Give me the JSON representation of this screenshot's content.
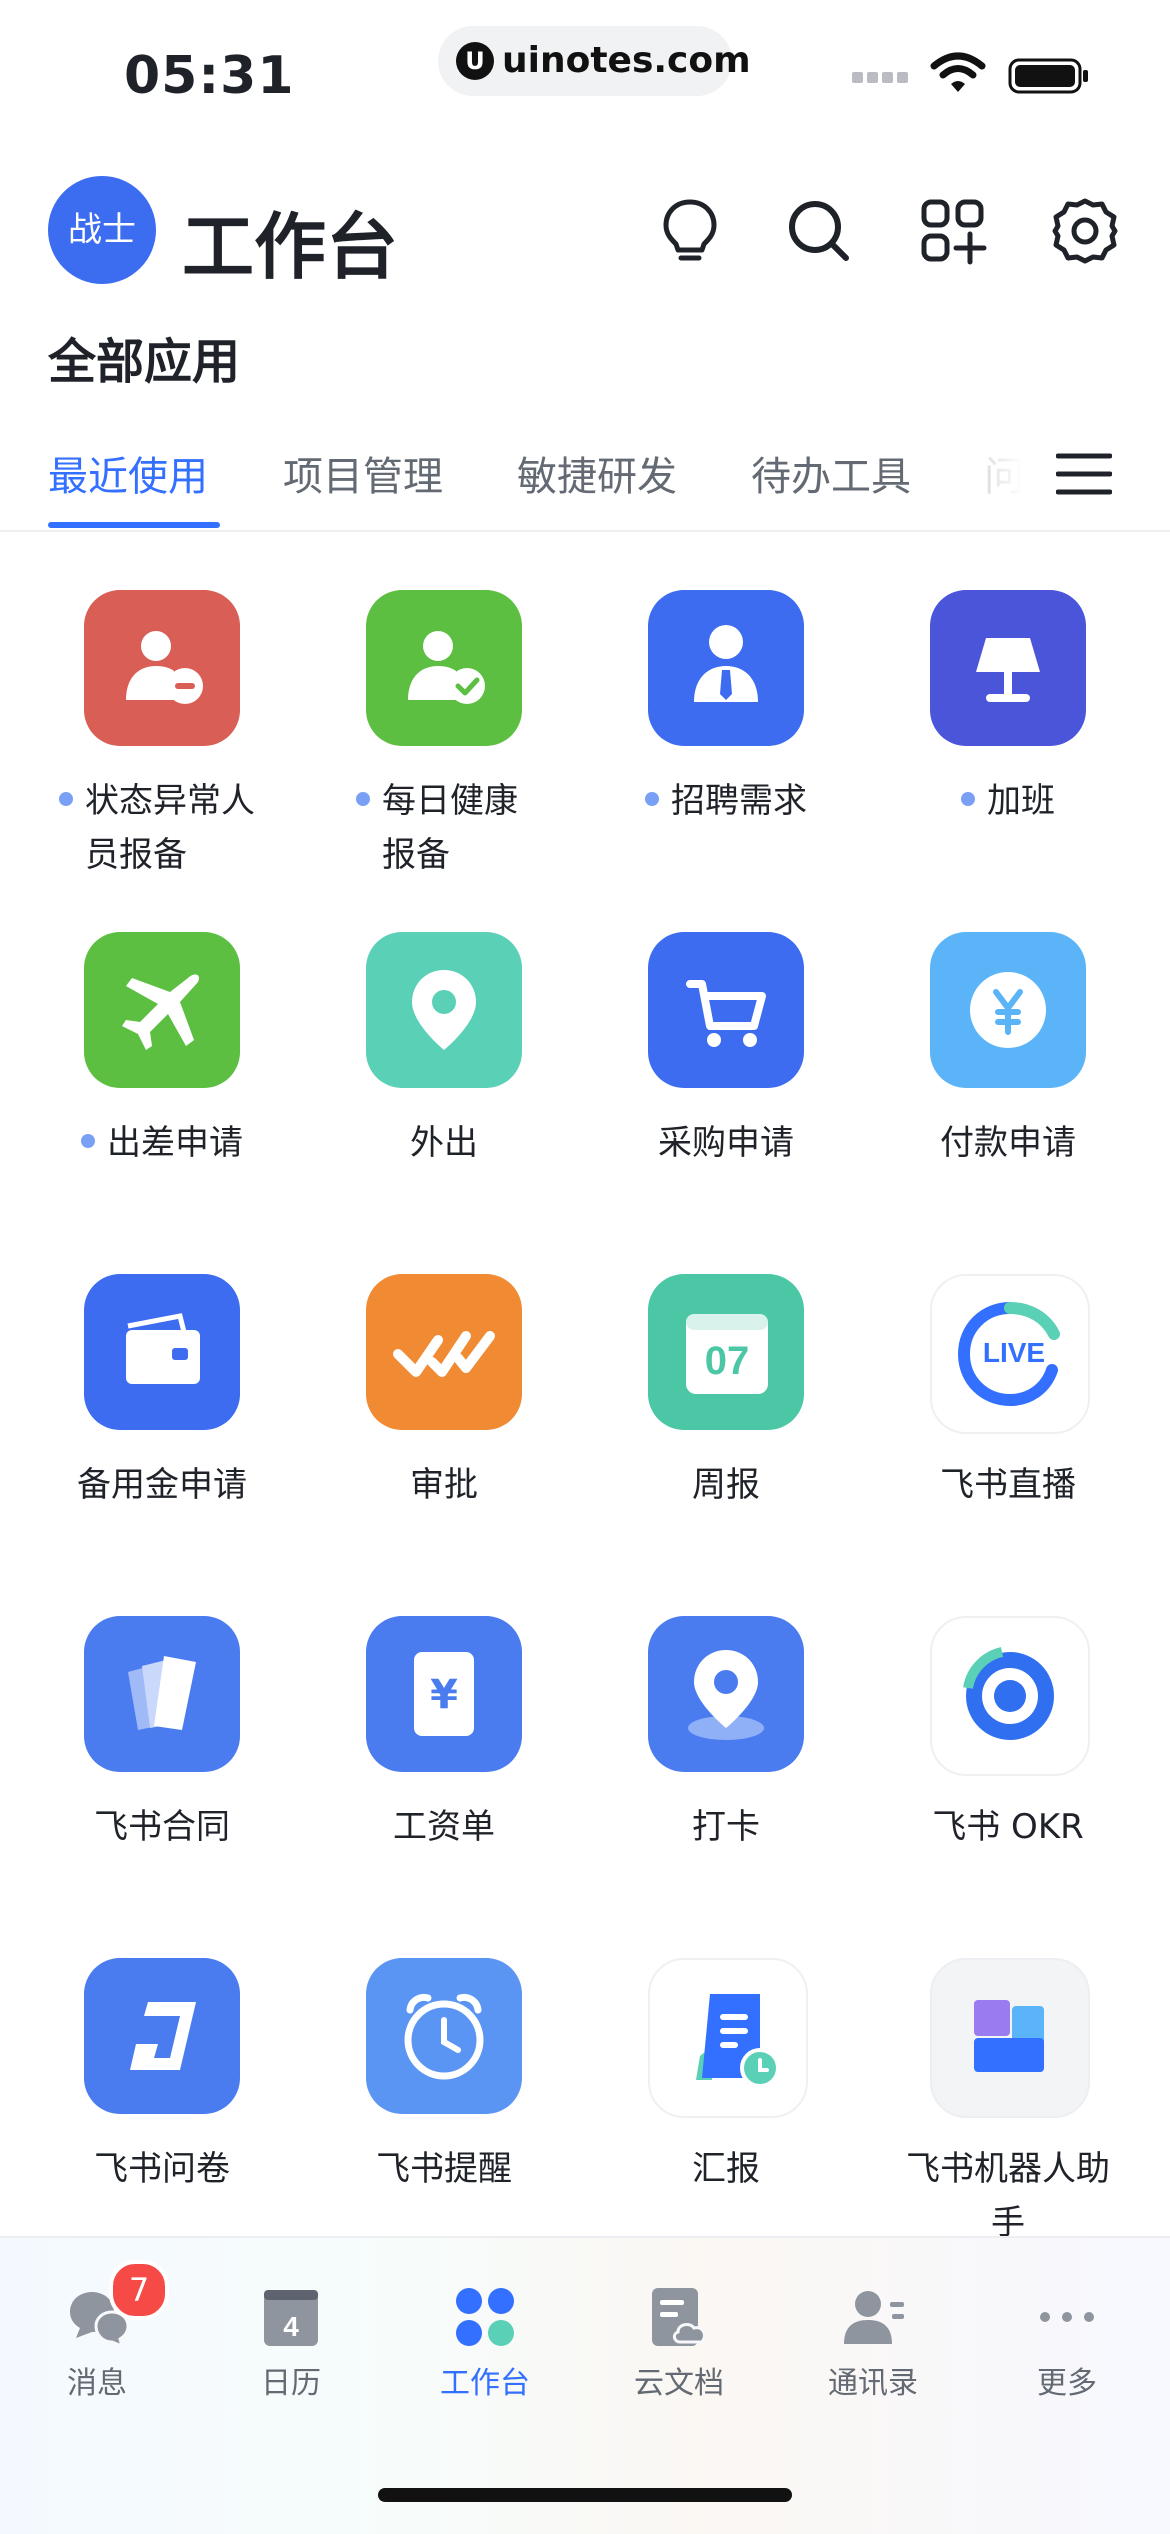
{
  "status_bar": {
    "time": "05:31",
    "url": "uinotes.com",
    "url_logo": "U"
  },
  "header": {
    "avatar_text": "战士",
    "title": "工作台"
  },
  "section_title": "全部应用",
  "tabs": [
    "最近使用",
    "项目管理",
    "敏捷研发",
    "待办工具",
    "问"
  ],
  "apps": [
    {
      "label": "状态异常人员报备",
      "dot": true,
      "icon": "user-remove-icon",
      "color": "#d95e55"
    },
    {
      "label": "每日健康报备",
      "dot": true,
      "icon": "user-check-icon",
      "color": "#5cbf42"
    },
    {
      "label": "招聘需求",
      "dot": true,
      "icon": "recruit-person-icon",
      "color": "#3d6cf1"
    },
    {
      "label": "加班",
      "dot": true,
      "icon": "lamp-icon",
      "color": "#4a55d9"
    },
    {
      "label": "出差申请",
      "dot": true,
      "icon": "airplane-icon",
      "color": "#5cbf42"
    },
    {
      "label": "外出",
      "dot": false,
      "icon": "location-pin-icon",
      "color": "#5ad0b6"
    },
    {
      "label": "采购申请",
      "dot": false,
      "icon": "shopping-cart-icon",
      "color": "#3d6cf1"
    },
    {
      "label": "付款申请",
      "dot": false,
      "icon": "yen-coin-icon",
      "color": "#5bb4f7"
    },
    {
      "label": "备用金申请",
      "dot": false,
      "icon": "wallet-icon",
      "color": "#3d6cf1"
    },
    {
      "label": "审批",
      "dot": false,
      "icon": "approval-check-icon",
      "color": "#f08a33"
    },
    {
      "label": "周报",
      "dot": false,
      "icon": "weekly-calendar-icon",
      "color": "#4cc7a5",
      "icon_text": "07"
    },
    {
      "label": "飞书直播",
      "dot": false,
      "icon": "live-icon",
      "color": "#ffffff",
      "icon_text": "LIVE"
    },
    {
      "label": "飞书合同",
      "dot": false,
      "icon": "contract-pages-icon",
      "color": "#4a7cf0"
    },
    {
      "label": "工资单",
      "dot": false,
      "icon": "payslip-icon",
      "color": "#4a7cf0",
      "icon_text": "¥"
    },
    {
      "label": "打卡",
      "dot": false,
      "icon": "check-in-pin-icon",
      "color": "#4a7cf0"
    },
    {
      "label": "飞书 OKR",
      "dot": false,
      "icon": "okr-target-icon",
      "color": "#ffffff"
    },
    {
      "label": "飞书问卷",
      "dot": false,
      "icon": "survey-icon",
      "color": "#4a7cf0"
    },
    {
      "label": "飞书提醒",
      "dot": false,
      "icon": "alarm-clock-icon",
      "color": "#5b95f3"
    },
    {
      "label": "汇报",
      "dot": false,
      "icon": "report-doc-icon",
      "color": "#ffffff"
    },
    {
      "label": "飞书机器人助手",
      "dot": false,
      "icon": "robot-blocks-icon",
      "color": "#f3f4f6"
    }
  ],
  "bottom_nav": [
    {
      "label": "消息",
      "icon": "chat-bubbles-icon",
      "badge": "7"
    },
    {
      "label": "日历",
      "icon": "calendar-icon",
      "icon_text": "4"
    },
    {
      "label": "工作台",
      "icon": "workspace-grid-icon",
      "active": true
    },
    {
      "label": "云文档",
      "icon": "cloud-doc-icon"
    },
    {
      "label": "通讯录",
      "icon": "contacts-icon"
    },
    {
      "label": "更多",
      "icon": "more-dots-icon"
    }
  ],
  "colors": {
    "accent": "#3370ff",
    "badge": "#f54a45",
    "text": "#1f2329",
    "muted": "#646a73"
  }
}
